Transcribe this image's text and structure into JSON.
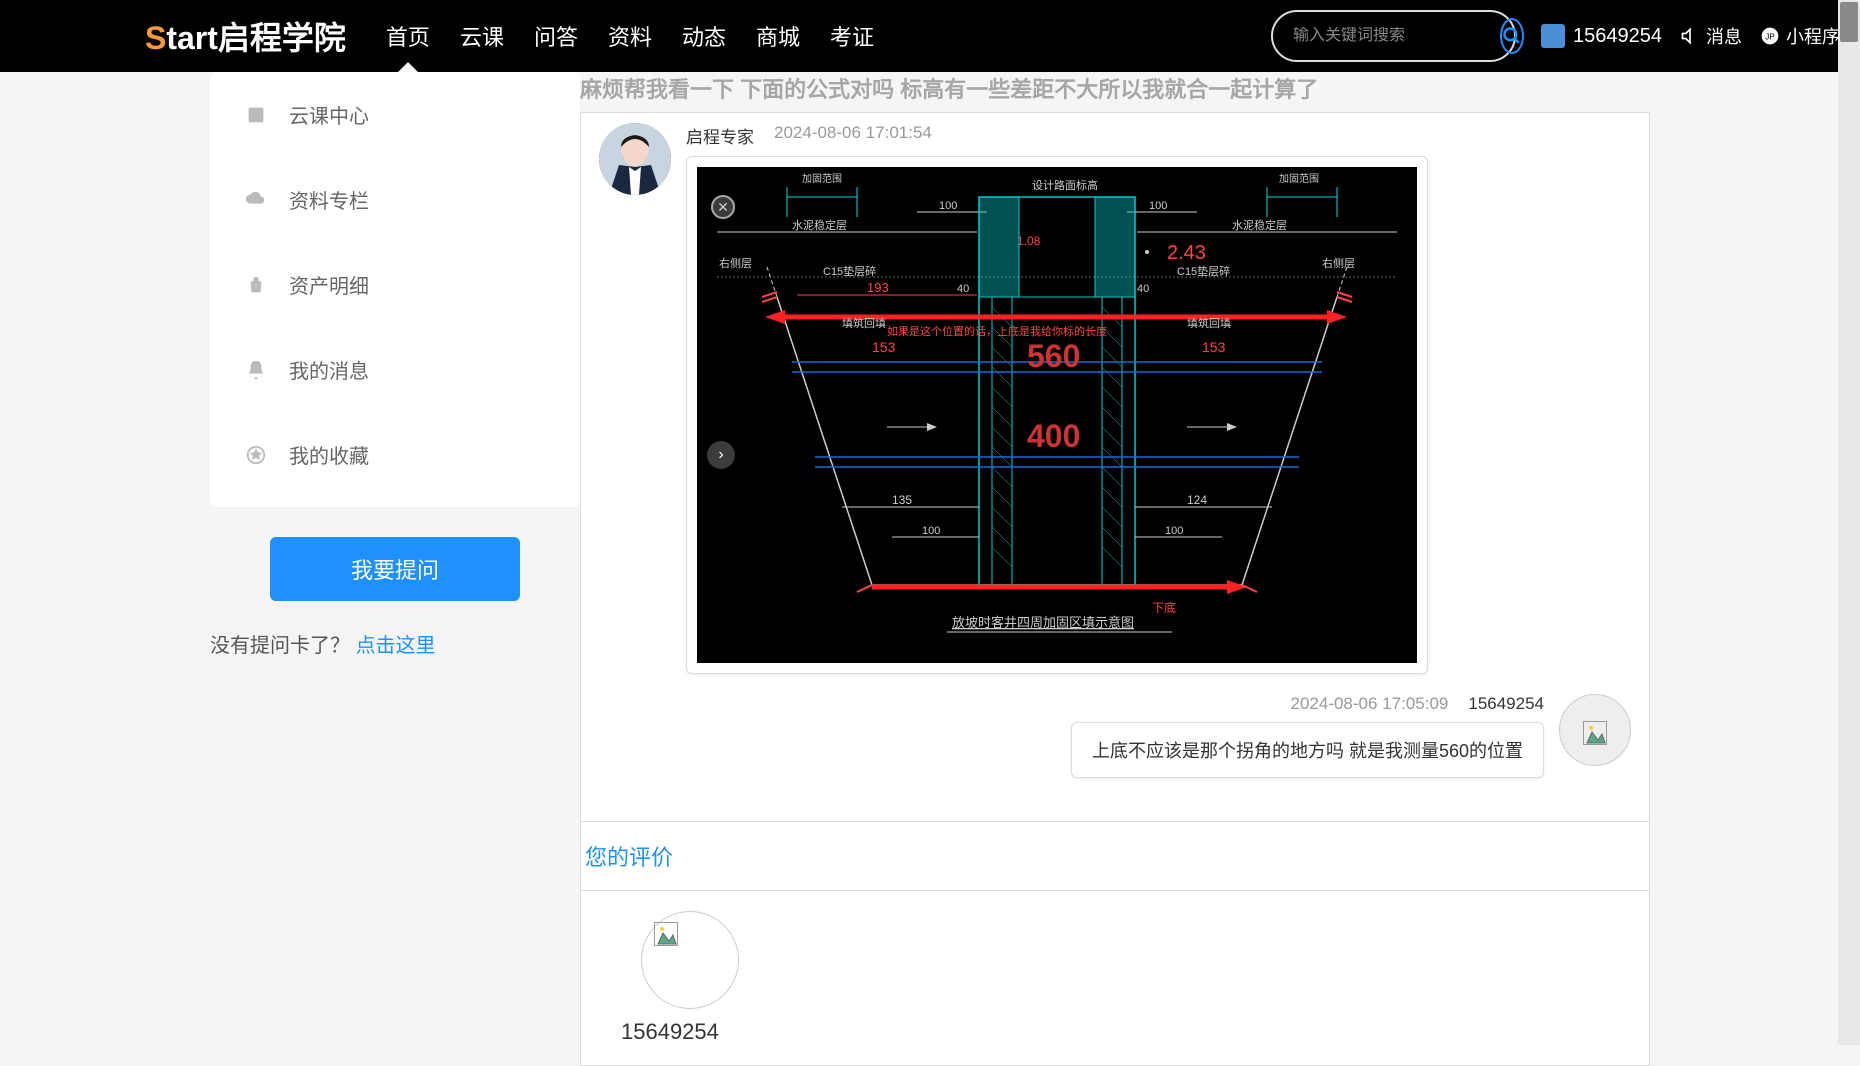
{
  "header": {
    "logo_s": "S",
    "logo_rest": "tart启程学院",
    "nav": [
      "首页",
      "云课",
      "问答",
      "资料",
      "动态",
      "商城",
      "考证"
    ],
    "search_placeholder": "输入关键词搜索",
    "username": "15649254",
    "messages_label": "消息",
    "miniapp_label": "小程序"
  },
  "sidebar": {
    "items": [
      {
        "label": "云课中心",
        "icon": "book"
      },
      {
        "label": "资料专栏",
        "icon": "cloud"
      },
      {
        "label": "资产明细",
        "icon": "bag"
      },
      {
        "label": "我的消息",
        "icon": "bell"
      },
      {
        "label": "我的收藏",
        "icon": "star"
      }
    ],
    "ask_button": "我要提问",
    "no_card_text": "没有提问卡了？",
    "no_card_link": "点击这里"
  },
  "main": {
    "question_title": "麻烦帮我看一下 下面的公式对吗 标高有一些差距不大所以我就合一起计算了",
    "review_title": "您的评价",
    "review_username": "15649254"
  },
  "messages": [
    {
      "side": "left",
      "author": "启程专家",
      "time": "2024-08-06 17:01:54",
      "type": "image"
    },
    {
      "side": "right",
      "author": "15649254",
      "time": "2024-08-06 17:05:09",
      "type": "text",
      "text": "上底不应该是那个拐角的地方吗 就是我测量560的位置"
    }
  ],
  "cad": {
    "title_top": "设计路面标高",
    "label_left_top": "水泥稳定层",
    "label_right_top": "水泥稳定层",
    "label_left_side": "右侧层",
    "label_right_side": "右侧层",
    "label_c15_left": "C15垫层碎",
    "label_c15_right": "C15垫层碎",
    "label_fill_left": "填筑回填",
    "label_fill_right": "填筑回填",
    "annotation_red": "如果是这个位置的话，上底是我给你标的长度",
    "bottom_title": "放坡时客井四周加固区填示意图",
    "bottom_label": "下底",
    "dims": {
      "v108": "1.08",
      "v243": "2.43",
      "v193": "193",
      "v40a": "40",
      "v40b": "40",
      "v153a": "153",
      "v153b": "153",
      "v560": "560",
      "v400": "400",
      "v135": "135",
      "v124": "124",
      "v100a": "100",
      "v100b": "100",
      "v100c": "100",
      "v100d": "100"
    },
    "top_labels": {
      "left": "加固范围",
      "right": "加固范围"
    }
  }
}
